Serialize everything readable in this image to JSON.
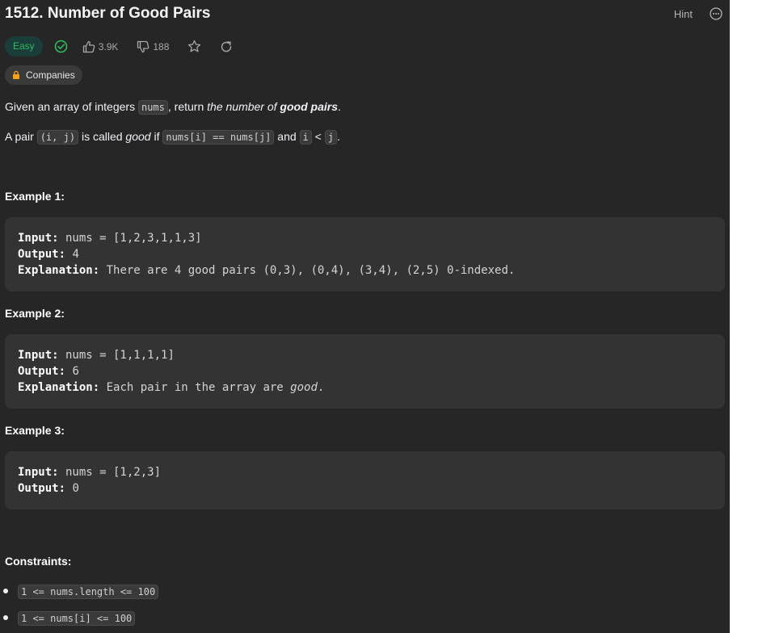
{
  "problem": {
    "title": "1512. Number of Good Pairs",
    "hint_label": "Hint",
    "difficulty": "Easy",
    "likes": "3.9K",
    "dislikes": "188",
    "companies_label": "Companies"
  },
  "description": {
    "line1": {
      "t1": "Given an array of integers ",
      "code1": "nums",
      "t2": ", return ",
      "em1": "the number of ",
      "strong1": "good pairs",
      "t3": "."
    },
    "line2": {
      "t1": "A pair ",
      "code1": "(i, j)",
      "t2": " is called ",
      "em1": "good",
      "t3": " if ",
      "code2": "nums[i] == nums[j]",
      "t4": " and ",
      "code3": "i",
      "t5": " < ",
      "code4": "j",
      "t6": "."
    }
  },
  "examples": [
    {
      "heading": "Example 1:",
      "input_label": "Input:",
      "input_value": " nums = [1,2,3,1,1,3]",
      "output_label": "Output:",
      "output_value": " 4",
      "explanation_label": "Explanation:",
      "explanation_value": " There are 4 good pairs (0,3), (0,4), (3,4), (2,5) 0-indexed."
    },
    {
      "heading": "Example 2:",
      "input_label": "Input:",
      "input_value": " nums = [1,1,1,1]",
      "output_label": "Output:",
      "output_value": " 6",
      "explanation_label": "Explanation:",
      "explanation_value": " Each pair in the array are ",
      "explanation_em": "good",
      "explanation_end": "."
    },
    {
      "heading": "Example 3:",
      "input_label": "Input:",
      "input_value": " nums = [1,2,3]",
      "output_label": "Output:",
      "output_value": " 0"
    }
  ],
  "constraints": {
    "heading": "Constraints:",
    "items": [
      "1 <= nums.length <= 100",
      "1 <= nums[i] <= 100"
    ]
  },
  "colors": {
    "panel_bg": "#262626",
    "example_bg": "#333333",
    "easy_green": "#2cbb5d",
    "accepted_green": "#2cbb5d",
    "companies_lock": "#ffa116"
  },
  "icons": [
    "solved-check-icon",
    "thumbs-up-icon",
    "thumbs-down-icon",
    "star-icon",
    "share-icon",
    "lock-icon",
    "more-options-icon"
  ]
}
